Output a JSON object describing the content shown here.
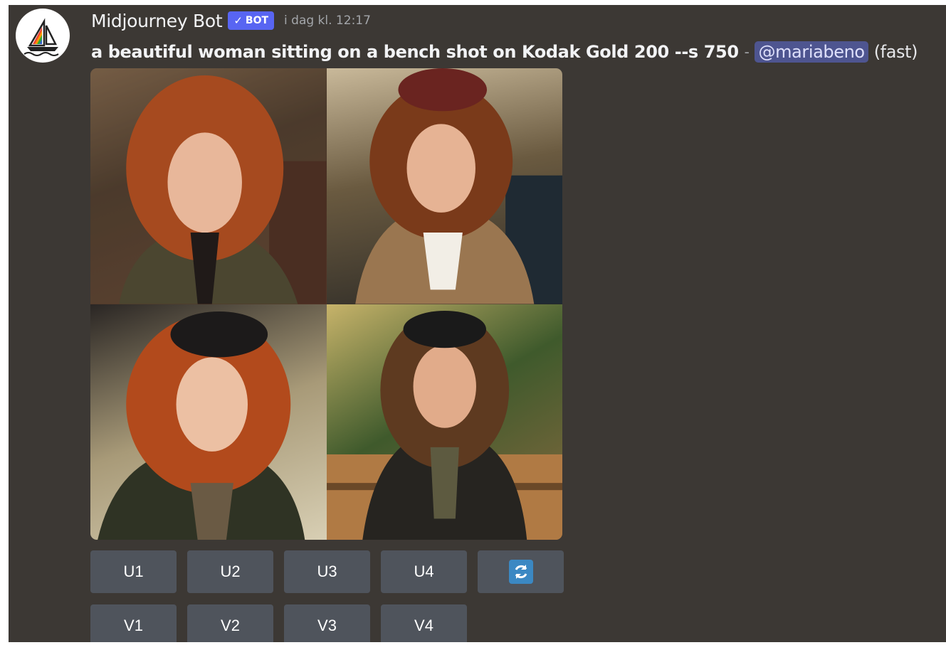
{
  "message": {
    "author": "Midjourney Bot",
    "badge": "BOT",
    "badge_check": "✓",
    "timestamp": "i dag kl. 12:17",
    "prompt": "a beautiful woman sitting on a bench shot on Kodak Gold 200 --s 750",
    "separator": "-",
    "mention": "@mariabeno",
    "speed": "(fast)"
  },
  "avatar_icon": "midjourney-sailboat-icon",
  "images": [
    {
      "name": "image-1",
      "description_icon": "portrait-photo"
    },
    {
      "name": "image-2",
      "description_icon": "portrait-photo"
    },
    {
      "name": "image-3",
      "description_icon": "portrait-photo"
    },
    {
      "name": "image-4",
      "description_icon": "portrait-photo"
    }
  ],
  "buttons": {
    "upscale": [
      "U1",
      "U2",
      "U3",
      "U4"
    ],
    "variation": [
      "V1",
      "V2",
      "V3",
      "V4"
    ],
    "reroll_icon": "arrows-counterclockwise-icon"
  },
  "colors": {
    "background": "#3c3834",
    "button": "#4f545c",
    "badge": "#5865f2",
    "mention_bg": "#4e5590",
    "reroll": "#3b88c3"
  }
}
